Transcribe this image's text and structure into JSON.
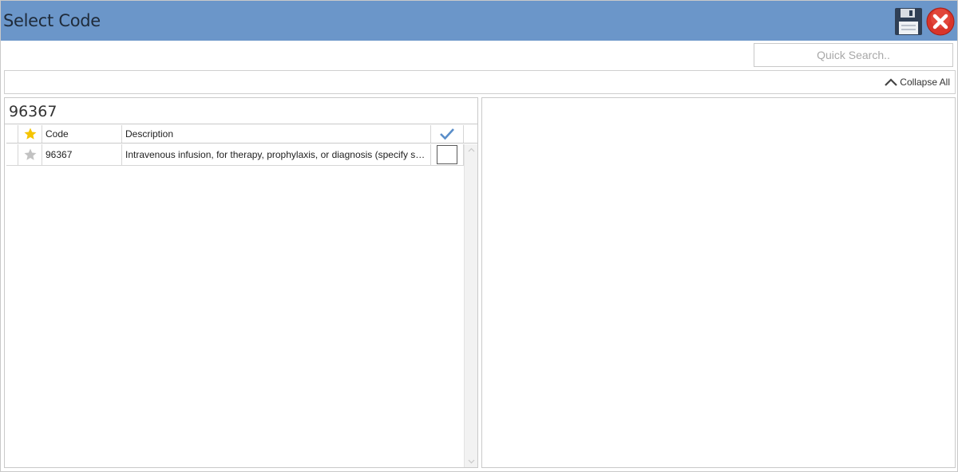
{
  "window": {
    "title": "Select Code"
  },
  "toolbar": {
    "save_icon": "floppy-disk-icon",
    "close_icon": "close-x-icon"
  },
  "search": {
    "placeholder": "Quick Search..",
    "value": ""
  },
  "collapse": {
    "label": "Collapse All",
    "icon": "chevron-up-icon"
  },
  "left_pane": {
    "heading": "96367",
    "grid": {
      "columns": [
        {
          "key": "favorite",
          "header_icon": "star-icon",
          "header_color": "#f5c400"
        },
        {
          "key": "code",
          "label": "Code"
        },
        {
          "key": "description",
          "label": "Description"
        },
        {
          "key": "selected",
          "header_icon": "checkmark-icon",
          "header_color": "#5a8ec9"
        }
      ],
      "rows": [
        {
          "favorite": false,
          "code": "96367",
          "description": "Intravenous infusion, for therapy, prophylaxis, or diagnosis (specify su...",
          "selected": false
        }
      ]
    }
  },
  "colors": {
    "titlebar": "#6b96c9",
    "star_active": "#f5c400",
    "star_inactive": "#c2c2c2",
    "close_red": "#d9352a"
  }
}
